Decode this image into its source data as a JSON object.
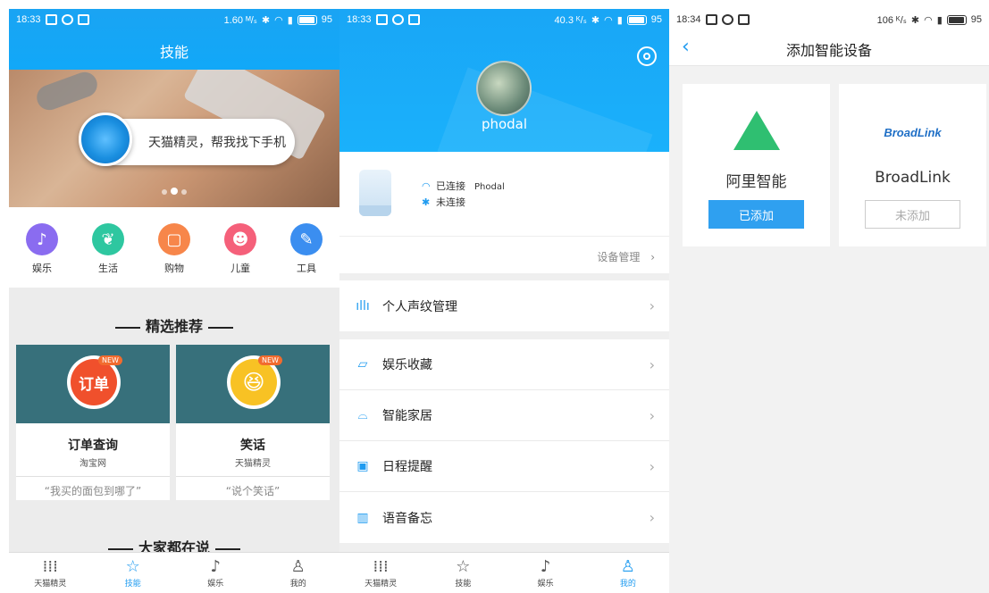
{
  "screen1": {
    "status": {
      "time": "18:33",
      "speed": "1.60 ᴹ/ₛ",
      "battery": "95"
    },
    "title": "技能",
    "banner": {
      "bubble_text": "天猫精灵，帮我找下手机"
    },
    "categories": [
      {
        "label": "娱乐",
        "icon": "music-note-icon",
        "color": "#8a6cf0"
      },
      {
        "label": "生活",
        "icon": "plant-icon",
        "color": "#2ec7a0"
      },
      {
        "label": "购物",
        "icon": "bag-icon",
        "color": "#f7864a"
      },
      {
        "label": "儿童",
        "icon": "child-face-icon",
        "color": "#f5607a"
      },
      {
        "label": "工具",
        "icon": "wrench-icon",
        "color": "#3b8ef0"
      }
    ],
    "section_featured": "精选推荐",
    "cards": [
      {
        "name": "订单查询",
        "sub": "淘宝网",
        "quote": "“我买的面包到哪了”",
        "badge": "订单",
        "badge_color": "#f0502c",
        "new": "NEW"
      },
      {
        "name": "笑话",
        "sub": "天猫精灵",
        "quote": "“说个笑话”",
        "badge": "😆",
        "badge_color": "#f8c224",
        "new": "NEW"
      }
    ],
    "section_popular": "大家都在说",
    "tabs": [
      {
        "label": "天猫精灵",
        "icon": "voice-bars-icon"
      },
      {
        "label": "技能",
        "icon": "star-icon"
      },
      {
        "label": "娱乐",
        "icon": "music-note-icon"
      },
      {
        "label": "我的",
        "icon": "person-icon"
      }
    ]
  },
  "screen2": {
    "status": {
      "time": "18:33",
      "speed": "40.3 ᴷ/ₛ",
      "battery": "95"
    },
    "username": "phodal",
    "device": {
      "wifi_status": "已连接",
      "wifi_name": "Phodal",
      "bt_status": "未连接"
    },
    "device_management": "设备管理",
    "voiceprint": "个人声纹管理",
    "menu": [
      {
        "label": "娱乐收藏",
        "icon": "folder-icon"
      },
      {
        "label": "智能家居",
        "icon": "sofa-icon"
      },
      {
        "label": "日程提醒",
        "icon": "calendar-icon"
      },
      {
        "label": "语音备忘",
        "icon": "voice-memo-icon"
      }
    ],
    "tabs": [
      {
        "label": "天猫精灵"
      },
      {
        "label": "技能"
      },
      {
        "label": "娱乐"
      },
      {
        "label": "我的"
      }
    ]
  },
  "screen3": {
    "status": {
      "time": "18:34",
      "speed": "106 ᴷ/ₛ",
      "battery": "95"
    },
    "title": "添加智能设备",
    "vendors": [
      {
        "name": "阿里智能",
        "button": "已添加",
        "logo_color": "#2fbf71"
      },
      {
        "name": "BroadLink",
        "button": "未添加",
        "logo_text": "BroadLink"
      }
    ]
  },
  "colors": {
    "accent": "#1f9bf0",
    "header_blue": "#19a6f6"
  }
}
